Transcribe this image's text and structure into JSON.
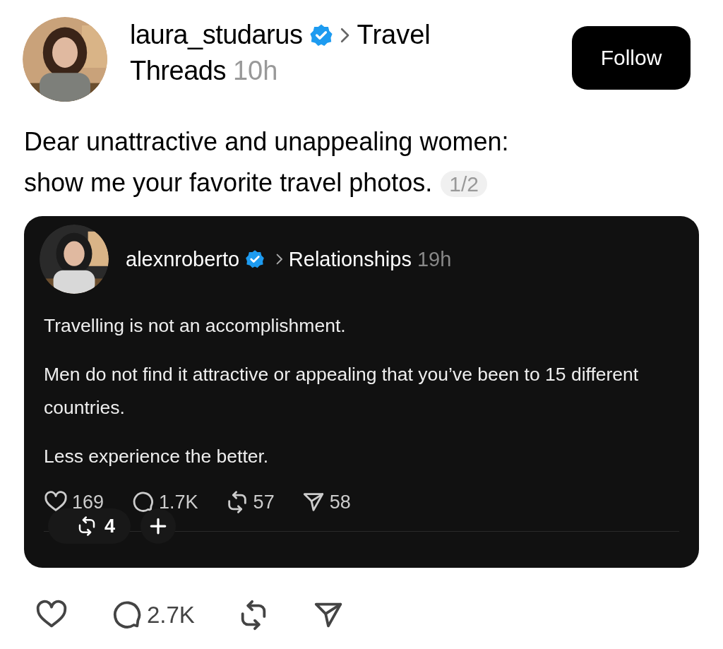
{
  "post": {
    "author": "laura_studarus",
    "verified": true,
    "topic": "Travel",
    "community": "Threads",
    "time": "10h",
    "follow_button": "Follow",
    "text_lines": [
      "Dear unattractive and unappealing women:",
      "show me your favorite travel photos."
    ],
    "page_indicator": "1/2"
  },
  "quoted_post": {
    "author": "alexnroberto",
    "verified": true,
    "topic": "Relationships",
    "time": "19h",
    "paragraphs": [
      "Travelling is not an accomplishment.",
      "Men do not find it attractive or appealing that you’ve been to 15 different countries.",
      "Less experience the better."
    ],
    "actions": [
      {
        "kind": "like",
        "count": "169"
      },
      {
        "kind": "reply",
        "count": "1.7K"
      },
      {
        "kind": "repost",
        "count": "57"
      },
      {
        "kind": "share",
        "count": "58"
      }
    ],
    "overlay": {
      "repost_count": "4"
    }
  },
  "actions": [
    {
      "kind": "like"
    },
    {
      "kind": "reply",
      "count": "2.7K"
    },
    {
      "kind": "repost"
    },
    {
      "kind": "share"
    }
  ]
}
